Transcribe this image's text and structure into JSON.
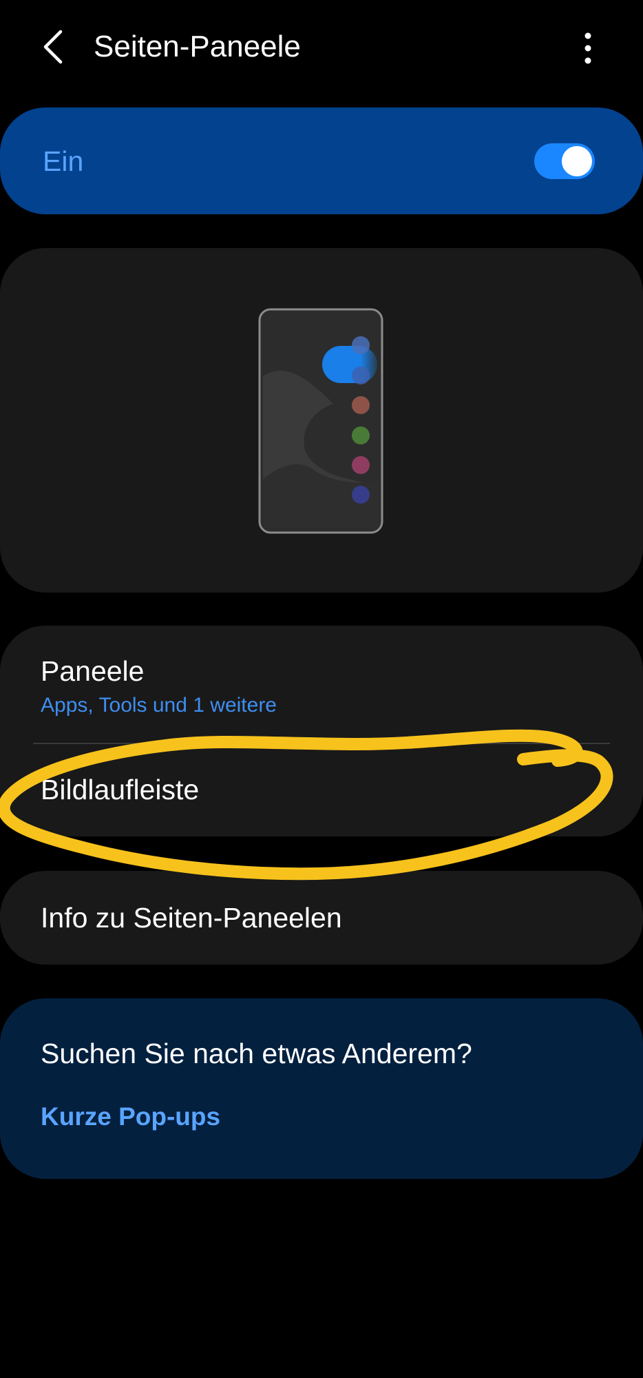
{
  "header": {
    "title": "Seiten-Paneele",
    "back_icon": "chevron-left-icon",
    "more_icon": "more-vertical-icon"
  },
  "master_switch": {
    "label": "Ein",
    "state": "on",
    "accent_color": "#1a86ff",
    "background_color": "#02428f"
  },
  "preview": {
    "dot_colors": [
      "#4a6fb8",
      "#3d61b0",
      "#a05a4e",
      "#4f8a3a",
      "#a0416a",
      "#3a3f9a"
    ],
    "handle_color": "#1a7fe8"
  },
  "settings": {
    "panels": {
      "label": "Paneele",
      "subtitle": "Apps, Tools und 1 weitere"
    },
    "scrollbar": {
      "label": "Bildlaufleiste"
    }
  },
  "info": {
    "label": "Info zu Seiten-Paneelen"
  },
  "suggestions": {
    "title": "Suchen Sie nach etwas Anderem?",
    "link": "Kurze Pop-ups"
  },
  "annotation": {
    "color": "#f7c21c"
  }
}
